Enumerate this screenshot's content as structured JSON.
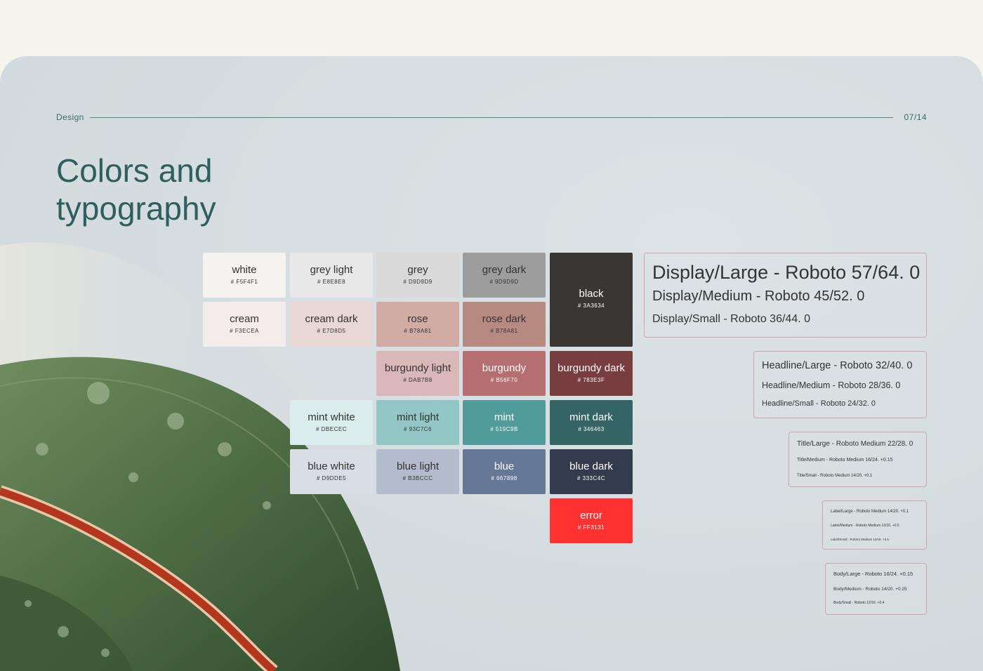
{
  "header": {
    "section": "Design",
    "page_number": "07/14"
  },
  "title": {
    "line1": "Colors and",
    "line2": "typography"
  },
  "colors": {
    "white": {
      "name": "white",
      "hex": "# F5F4F1",
      "color": "#F5F4F1"
    },
    "grey_light": {
      "name": "grey light",
      "hex": "# E8E8E8",
      "color": "#E8E8E8"
    },
    "grey": {
      "name": "grey",
      "hex": "# D9D9D9",
      "color": "#D9D9D9"
    },
    "grey_dark": {
      "name": "grey dark",
      "hex": "# 9D9D9D",
      "color": "#9D9D9D"
    },
    "black": {
      "name": "black",
      "hex": "# 3A3634",
      "color": "#3A3634"
    },
    "cream": {
      "name": "cream",
      "hex": "# F3ECEA",
      "color": "#F3ECEA"
    },
    "cream_dark": {
      "name": "cream dark",
      "hex": "# E7D8D5",
      "color": "#E7D8D5"
    },
    "rose": {
      "name": "rose",
      "hex": "# B78A81",
      "color": "#D2ABA5"
    },
    "rose_dark": {
      "name": "rose dark",
      "hex": "# B78A81",
      "color": "#B78A81"
    },
    "burgundy_light": {
      "name": "burgundy light",
      "hex": "# DAB7B8",
      "color": "#DAB7B8"
    },
    "burgundy": {
      "name": "burgundy",
      "hex": "# B56F70",
      "color": "#B56F70"
    },
    "burgundy_dark": {
      "name": "burgundy dark",
      "hex": "# 783E3F",
      "color": "#783E3F"
    },
    "mint_white": {
      "name": "mint white",
      "hex": "# DBECEC",
      "color": "#DBECEC"
    },
    "mint_light": {
      "name": "mint light",
      "hex": "# 93C7C6",
      "color": "#93C7C6"
    },
    "mint": {
      "name": "mint",
      "hex": "# 519C9B",
      "color": "#519C9B"
    },
    "mint_dark": {
      "name": "mint dark",
      "hex": "# 346463",
      "color": "#346463"
    },
    "blue_white": {
      "name": "blue white",
      "hex": "# D9DDE5",
      "color": "#D9DDE5"
    },
    "blue_light": {
      "name": "blue light",
      "hex": "# B3BCCC",
      "color": "#B3BCCC"
    },
    "blue": {
      "name": "blue",
      "hex": "# 667898",
      "color": "#667898"
    },
    "blue_dark": {
      "name": "blue dark",
      "hex": "# 333C4C",
      "color": "#333C4C"
    },
    "error": {
      "name": "error",
      "hex": "# FF3131",
      "color": "#FF3131"
    }
  },
  "typography": {
    "display": [
      "Display/Large - Roboto 57/64. 0",
      "Display/Medium - Roboto 45/52. 0",
      "Display/Small - Roboto 36/44. 0"
    ],
    "headline": [
      "Headline/Large - Roboto 32/40. 0",
      "Headline/Medium - Roboto 28/36. 0",
      "Headline/Small - Roboto 24/32. 0"
    ],
    "title": [
      "Title/Large - Roboto Medium 22/28. 0",
      "Title/Medium - Roboto Medium 16/24. +0.15",
      "Title/Small - Roboto Medium 14/20. +0.1"
    ],
    "label": [
      "Label/Large - Roboto Medium 14/20. +0.1",
      "Label/Medium - Roboto Medium 12/16. +0.5",
      "Label/Small - Roboto Medium 11/16. +0.5"
    ],
    "body": [
      "Body/Large - Roboto 16/24. +0.15",
      "Body/Medium - Roboto 14/20. +0.25",
      "Body/Small - Roboto 12/16. +0.4"
    ]
  }
}
